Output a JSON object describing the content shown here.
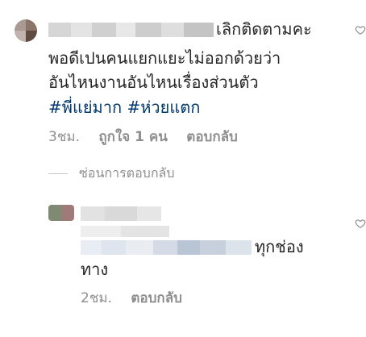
{
  "comment1": {
    "text_line1": "เลิกติดตามคะ",
    "text_line2": "พอดีเปนคนแยกแยะไม่ออกด้วยว่า",
    "text_line3": "อันไหนงานอันไหนเรื่องส่วนตัว",
    "hashtag1": "#พี่แย่มาก",
    "hashtag2": "#ห่วยแตก",
    "time": "3ชม.",
    "likes": "ถูกใจ 1 คน",
    "reply": "ตอบกลับ"
  },
  "hide_replies": "ซ่อนการตอบกลับ",
  "comment2": {
    "text_line1": "ทุกช่อง",
    "text_line2": "ทาง",
    "time": "2ชม.",
    "reply": "ตอบกลับ"
  },
  "colors": {
    "text": "#262626",
    "meta": "#8e8e8e",
    "hashtag": "#00376b"
  },
  "icons": {
    "heart": "heart-outline-icon"
  }
}
